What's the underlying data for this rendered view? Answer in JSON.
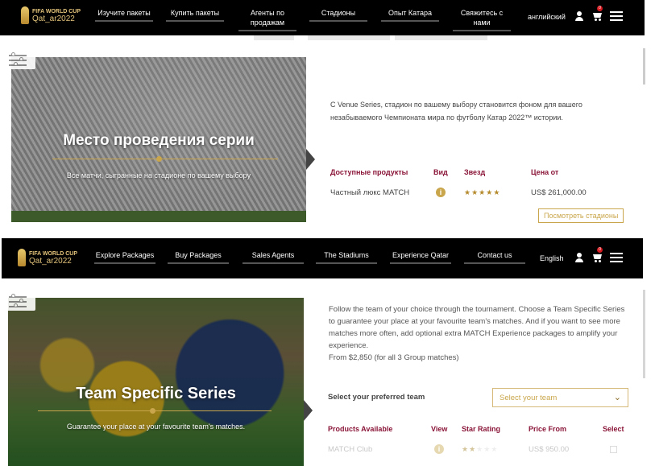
{
  "ru": {
    "logo": {
      "line1": "FIFA WORLD CUP",
      "line2": "Qat_ar2022"
    },
    "nav": [
      {
        "label": "Изучите пакеты"
      },
      {
        "label": "Купить пакеты"
      },
      {
        "label": "Агенты по продажам"
      },
      {
        "label": "Стадионы"
      },
      {
        "label": "Опыт Катара"
      },
      {
        "label": "Свяжитесь с нами"
      }
    ],
    "language": "английский",
    "cart_count": "0",
    "hero": {
      "title": "Место проведения серии",
      "subtitle": "Все матчи, сыгранные на стадионе по вашему выбору"
    },
    "description": "С Venue Series, стадион по вашему выбору становится фоном для вашего незабываемого Чемпионата мира по футболу Катар 2022™ истории.",
    "table": {
      "headers": {
        "products": "Доступные продукты",
        "view": "Вид",
        "stars": "Звезд",
        "price": "Цена от"
      },
      "row": {
        "product": "Частный люкс MATCH",
        "rating": 5,
        "price": "US$ 261,000.00"
      }
    },
    "view_stadiums_button": "Посмотреть стадионы"
  },
  "en": {
    "logo": {
      "line1": "FIFA WORLD CUP",
      "line2": "Qat_ar2022"
    },
    "nav": [
      {
        "label": "Explore Packages"
      },
      {
        "label": "Buy Packages"
      },
      {
        "label": "Sales Agents"
      },
      {
        "label": "The Stadiums"
      },
      {
        "label": "Experience Qatar"
      },
      {
        "label": "Contact us"
      }
    ],
    "language": "English",
    "cart_count": "0",
    "hero": {
      "title": "Team Specific Series",
      "subtitle": "Guarantee your place at your favourite team's matches."
    },
    "description": "Follow the team of your choice through the tournament. Choose a Team Specific Series to guarantee your place at your favourite team's matches. And if you want to see more matches more often, add optional extra MATCH Experience packages to amplify your experience.",
    "price_from": "From $2,850 (for all 3 Group matches)",
    "team_select": {
      "label": "Select your preferred team",
      "placeholder": "Select your team"
    },
    "table": {
      "headers": {
        "products": "Products Available",
        "view": "View",
        "stars": "Star Rating",
        "price": "Price From",
        "select": "Select"
      },
      "row": {
        "product": "MATCH Club",
        "rating": 2,
        "price": "US$ 950.00"
      }
    }
  },
  "colors": {
    "accent_gold": "#c9a64b",
    "header_maroon": "#8a1538",
    "nav_bg": "#000000"
  },
  "icons": [
    "filter-icon",
    "user-icon",
    "cart-icon",
    "menu-icon",
    "info-icon",
    "star-icon",
    "chevron-down-icon"
  ]
}
